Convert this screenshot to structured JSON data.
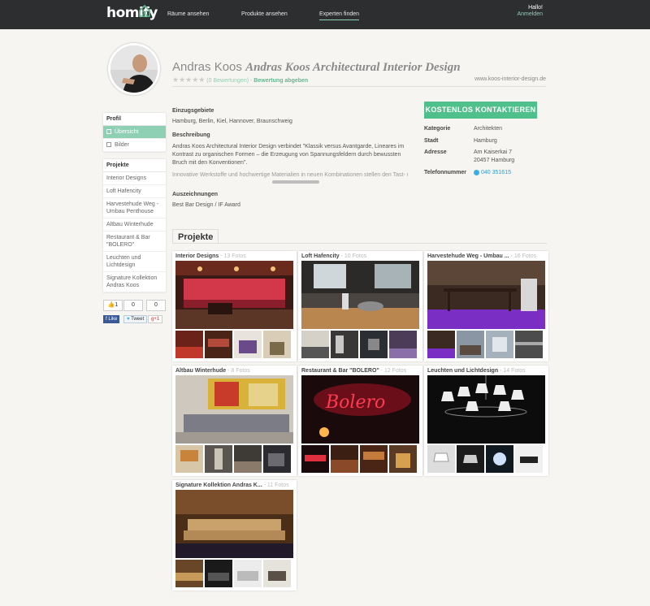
{
  "header": {
    "logo": "homify",
    "nav": [
      "Räume ansehen",
      "Produkte ansehen",
      "Experten finden"
    ],
    "greeting": "Hallo!",
    "login": "Anmelden"
  },
  "profile": {
    "name_plain": "Andras Koos",
    "name_italic": "Andras Koos Architectural Interior Design",
    "stars": "★★★★★",
    "reviews": "(0 Bewertungen)",
    "separator": " - ",
    "rate_link": "Bewertung abgeben",
    "website": "www.koos-interior-design.de"
  },
  "sidebar": {
    "profil_heading": "Profil",
    "profil_items": [
      "Übersicht",
      "Bilder"
    ],
    "projekte_heading": "Projekte",
    "projekte_items": [
      "Interior Designs",
      "Loft Hafencity",
      "Harvestehude Weg - Umbau Penthouse",
      "Altbau Winterhude",
      "Restaurant & Bar \"BOLERO\"",
      "Leuchten und Lichtdesign",
      "Signature Kollektion Andras Koos"
    ],
    "social": {
      "like_count": "1",
      "tweet_count": "0",
      "plus_count": "0",
      "fb_label": "Like",
      "tw_label": "Tweet",
      "gp_label": "+1"
    }
  },
  "info": {
    "einzug_label": "Einzugsgebiete",
    "einzug_value": "Hamburg, Berlin, Kiel, Hannover, Braunschweig",
    "beschreibung_label": "Beschreibung",
    "beschreibung_1": "Andras Koos Architectural Interior Design verbindet \"Klassik versus Avantgarde, Lineares im Kontrast zu organischen Formen – die Erzeugung von Spannungsfeldern durch bewussten Bruch mit den Konventionen\".",
    "beschreibung_2": "Innovative Werkstoffe und hochwertige Materialien in neuen Kombinationen stellen den Tast- und",
    "auszeichnungen_label": "Auszeichnungen",
    "auszeichnungen_value": "Best Bar Design / IF Award"
  },
  "contact": {
    "button": "KOSTENLOS KONTAKTIEREN",
    "kategorie_label": "Kategorie",
    "kategorie_value": "Architekten",
    "stadt_label": "Stadt",
    "stadt_value": "Hamburg",
    "adresse_label": "Adresse",
    "adresse_line1": "Am Kaiserkai 7",
    "adresse_line2": "20457 Hamburg",
    "telefon_label": "Telefonnummer",
    "telefon_value": "040 351615"
  },
  "projects": {
    "tab": "Projekte",
    "cards": [
      {
        "title": "Interior Designs",
        "count": " - 13 Fotos"
      },
      {
        "title": "Loft Hafencity",
        "count": " - 10 Fotos"
      },
      {
        "title": "Harvestehude Weg - Umbau ...",
        "count": " - 16 Fotos"
      },
      {
        "title": "Altbau Winterhude",
        "count": " - 8 Fotos"
      },
      {
        "title": "Restaurant & Bar \"BOLERO\"",
        "count": " - 12 Fotos"
      },
      {
        "title": "Leuchten und Lichtdesign",
        "count": " - 14 Fotos"
      },
      {
        "title": "Signature Kollektion Andras K...",
        "count": " - 11 Fotos"
      }
    ]
  },
  "colors": {
    "accent": "#4fbf8b",
    "accent_light": "#8ed0b4",
    "topbar": "#2d2e30"
  }
}
